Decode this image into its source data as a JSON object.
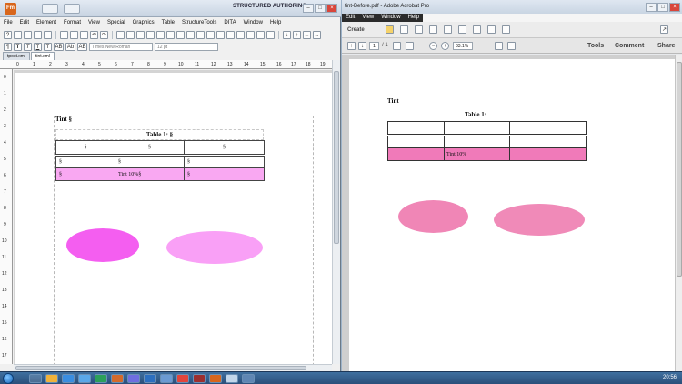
{
  "framemaker": {
    "logo": "Fm",
    "mode_label": "STRUCTURED AUTHORING",
    "menu": [
      "File",
      "Edit",
      "Element",
      "Format",
      "View",
      "Special",
      "Graphics",
      "Table",
      "StructureTools",
      "DITA",
      "Window",
      "Help"
    ],
    "font_name": "Times New Roman",
    "font_size": "12 pt",
    "format_buttons": [
      "T",
      "T",
      "T",
      "T",
      "AB",
      "Ab",
      "AB"
    ],
    "tabs": [
      "tpost.xml",
      "tint.xml"
    ],
    "ruler_h": [
      "0",
      "1",
      "2",
      "3",
      "4",
      "5",
      "6",
      "7",
      "8",
      "9",
      "10",
      "11",
      "12",
      "13",
      "14",
      "15",
      "16",
      "17",
      "18",
      "19"
    ],
    "ruler_v": [
      "0",
      "1",
      "2",
      "3",
      "4",
      "5",
      "6",
      "7",
      "8",
      "9",
      "10",
      "11",
      "12",
      "13",
      "14",
      "15",
      "16",
      "17"
    ],
    "doc": {
      "tint_label": "Tint §",
      "table_title": "Table 1: §",
      "header_cells": [
        "§",
        "§",
        "§"
      ],
      "row1": [
        "§",
        "§",
        "§"
      ],
      "row2": [
        "§",
        "Tint 10%§",
        "§"
      ]
    },
    "shapes": [
      {
        "name": "magenta-ellipse",
        "color": "#f45ef0"
      },
      {
        "name": "light-magenta-ellipse",
        "color": "#f9a0f6"
      }
    ]
  },
  "acrobat": {
    "title": "tint-Before.pdf - Adobe Acrobat Pro",
    "menu": [
      "Edit",
      "View",
      "Window",
      "Help"
    ],
    "create_label": "Create",
    "page_current": "1",
    "page_total": "/ 1",
    "zoom": "83.1%",
    "right_buttons": [
      "Tools",
      "Comment",
      "Share"
    ],
    "doc": {
      "tint_label": "Tint",
      "table_caption": "Table 1:",
      "row2_middle": "Tint 10%"
    },
    "shapes": [
      {
        "name": "pink-ellipse-1",
        "color": "#f086b6"
      },
      {
        "name": "pink-ellipse-2",
        "color": "#f08ab8"
      }
    ]
  },
  "taskbar": {
    "clock": "20:56"
  }
}
